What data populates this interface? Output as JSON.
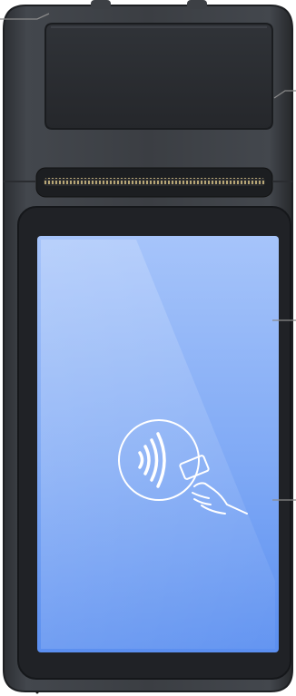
{
  "device": {
    "type": "android-pos-terminal",
    "colors": {
      "body": "#3a3d42",
      "body_edge": "#1f2124",
      "printer_cover": "#2b2e32",
      "screen_top": "#a9c7fb",
      "screen_bottom": "#5a8ff0",
      "icon_line": "#ffffff",
      "callout_line": "#8a8a8a"
    }
  },
  "screen": {
    "icon": "contactless-tap-card-icon",
    "text": ""
  },
  "callouts": [
    {
      "name": "callout-top-left"
    },
    {
      "name": "callout-printer-cover"
    },
    {
      "name": "callout-screen-upper"
    },
    {
      "name": "callout-screen-lower"
    }
  ]
}
